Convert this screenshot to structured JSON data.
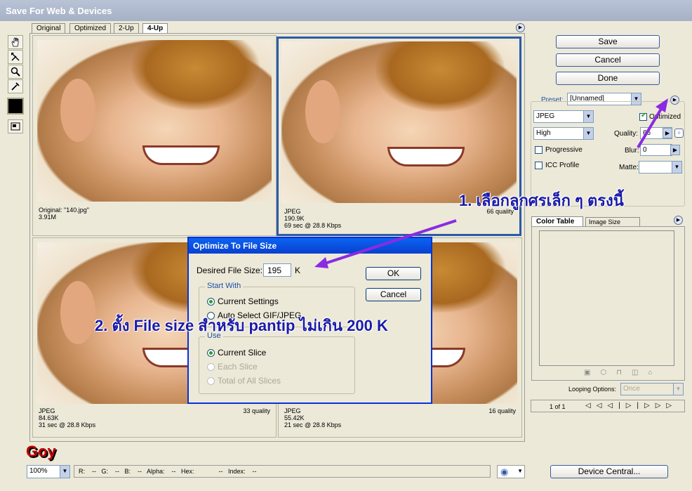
{
  "window": {
    "title": "Save For Web & Devices"
  },
  "view_tabs": [
    "Original",
    "Optimized",
    "2-Up",
    "4-Up"
  ],
  "active_tab": "4-Up",
  "panes": [
    {
      "line1": "Original: \"140.jpg\"",
      "line2": "3.91M",
      "line3": "",
      "quality": ""
    },
    {
      "line1": "JPEG",
      "line2": "190.9K",
      "line3": "69 sec @ 28.8 Kbps",
      "quality": "66 quality"
    },
    {
      "line1": "JPEG",
      "line2": "84.63K",
      "line3": "31 sec @ 28.8 Kbps",
      "quality": "33 quality"
    },
    {
      "line1": "JPEG",
      "line2": "55.42K",
      "line3": "21 sec @ 28.8 Kbps",
      "quality": "16 quality"
    }
  ],
  "buttons": {
    "save": "Save",
    "cancel": "Cancel",
    "done": "Done",
    "device_central": "Device Central..."
  },
  "settings": {
    "preset_label": "Preset:",
    "preset_value": "[Unnamed]",
    "format": "JPEG",
    "quality_level": "High",
    "optimized_label": "Optimized",
    "optimized_display": "Optimized",
    "quality_label": "Quality:",
    "quality_value": "66",
    "blur_label": "Blur:",
    "blur_value": "0",
    "progressive_label": "Progressive",
    "icc_label": "ICC Profile",
    "matte_label": "Matte:"
  },
  "color_panel": {
    "tabs": [
      "Color Table",
      "Image Size"
    ],
    "looping_label": "Looping Options:",
    "looping_value": "Once",
    "frame_counter": "1 of 1"
  },
  "dialog": {
    "title": "Optimize To File Size",
    "desired_label": "Desired File Size:",
    "desired_value": "195",
    "unit": "K",
    "ok": "OK",
    "cancel": "Cancel",
    "start_with_title": "Start With",
    "current_settings": "Current Settings",
    "auto_select": "Auto Select GIF/JPEG",
    "use_title": "Use",
    "current_slice": "Current Slice",
    "each_slice": "Each Slice",
    "total_slices": "Total of All Slices"
  },
  "annotations": {
    "step1": "1. เลือกลูกศรเล็ก ๆ ตรงนี้",
    "step2": "2. ตั้ง File size สำหรับ pantip ไม่เกิน 200 K",
    "signature": "Goy"
  },
  "status": {
    "zoom": "100%",
    "readout": "R:    --   G:    --   B:    --   Alpha:    --   Hex:              --   Index:    --"
  }
}
